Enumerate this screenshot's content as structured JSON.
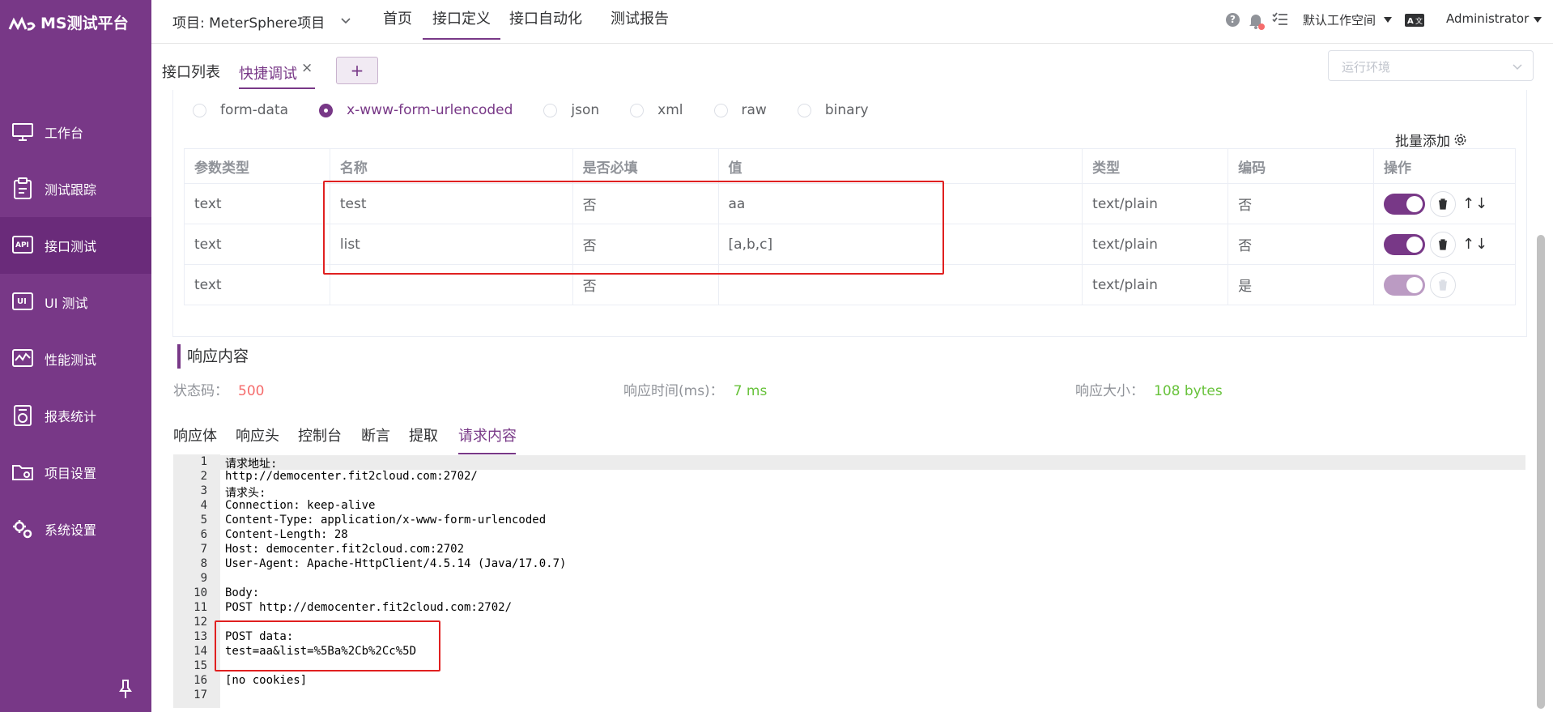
{
  "app": {
    "logo_text": "MS测试平台"
  },
  "sidebar": {
    "items": [
      {
        "label": "工作台",
        "icon": "monitor-icon"
      },
      {
        "label": "测试跟踪",
        "icon": "clipboard-icon"
      },
      {
        "label": "接口测试",
        "icon": "api-icon"
      },
      {
        "label": "UI 测试",
        "icon": "ui-test-icon"
      },
      {
        "label": "性能测试",
        "icon": "performance-chart-icon"
      },
      {
        "label": "报表统计",
        "icon": "report-icon"
      },
      {
        "label": "项目设置",
        "icon": "folder-settings-icon"
      },
      {
        "label": "系统设置",
        "icon": "gears-icon"
      }
    ],
    "active_index": 2
  },
  "header": {
    "project": "项目: MeterSphere项目",
    "menu": [
      "首页",
      "接口定义",
      "接口自动化",
      "测试报告"
    ],
    "active_menu": "接口定义",
    "workspace": "默认工作空间",
    "user": "Administrator"
  },
  "tabs": {
    "list_label": "接口列表",
    "debug_label": "快捷调试",
    "close_symbol": "×",
    "add_symbol": "+"
  },
  "env": {
    "placeholder": "运行环境"
  },
  "body_types": {
    "options": [
      "form-data",
      "x-www-form-urlencoded",
      "json",
      "xml",
      "raw",
      "binary"
    ],
    "selected": "x-www-form-urlencoded"
  },
  "batch_add": "批量添加",
  "params_table": {
    "headers": [
      "参数类型",
      "名称",
      "是否必填",
      "值",
      "类型",
      "编码",
      "操作"
    ],
    "rows": [
      [
        "text",
        "test",
        "否",
        "aa",
        "text/plain",
        "否"
      ],
      [
        "text",
        "list",
        "否",
        "[a,b,c]",
        "text/plain",
        "否"
      ],
      [
        "text",
        "",
        "否",
        "",
        "text/plain",
        "是"
      ]
    ],
    "move_arrows": "↑↓"
  },
  "response": {
    "title": "响应内容",
    "status_label": "状态码：",
    "status_value": "500",
    "time_label": "响应时间(ms)：",
    "time_value": "7 ms",
    "size_label": "响应大小：",
    "size_value": "108 bytes",
    "tabs": [
      "响应体",
      "响应头",
      "控制台",
      "断言",
      "提取",
      "请求内容"
    ],
    "active_tab": "请求内容"
  },
  "editor_lines": [
    "请求地址:",
    "http://democenter.fit2cloud.com:2702/",
    "请求头:",
    "Connection: keep-alive",
    "Content-Type: application/x-www-form-urlencoded",
    "Content-Length: 28",
    "Host: democenter.fit2cloud.com:2702",
    "User-Agent: Apache-HttpClient/4.5.14 (Java/17.0.7)",
    "",
    "Body:",
    "POST http://democenter.fit2cloud.com:2702/",
    "",
    "POST data:",
    "test=aa&list=%5Ba%2Cb%2Cc%5D",
    "",
    "[no cookies]",
    ""
  ],
  "colors": {
    "brand": "#783887",
    "status_error": "#f56c6c",
    "ok_green": "#67c23a",
    "highlight_red": "#e02020"
  }
}
